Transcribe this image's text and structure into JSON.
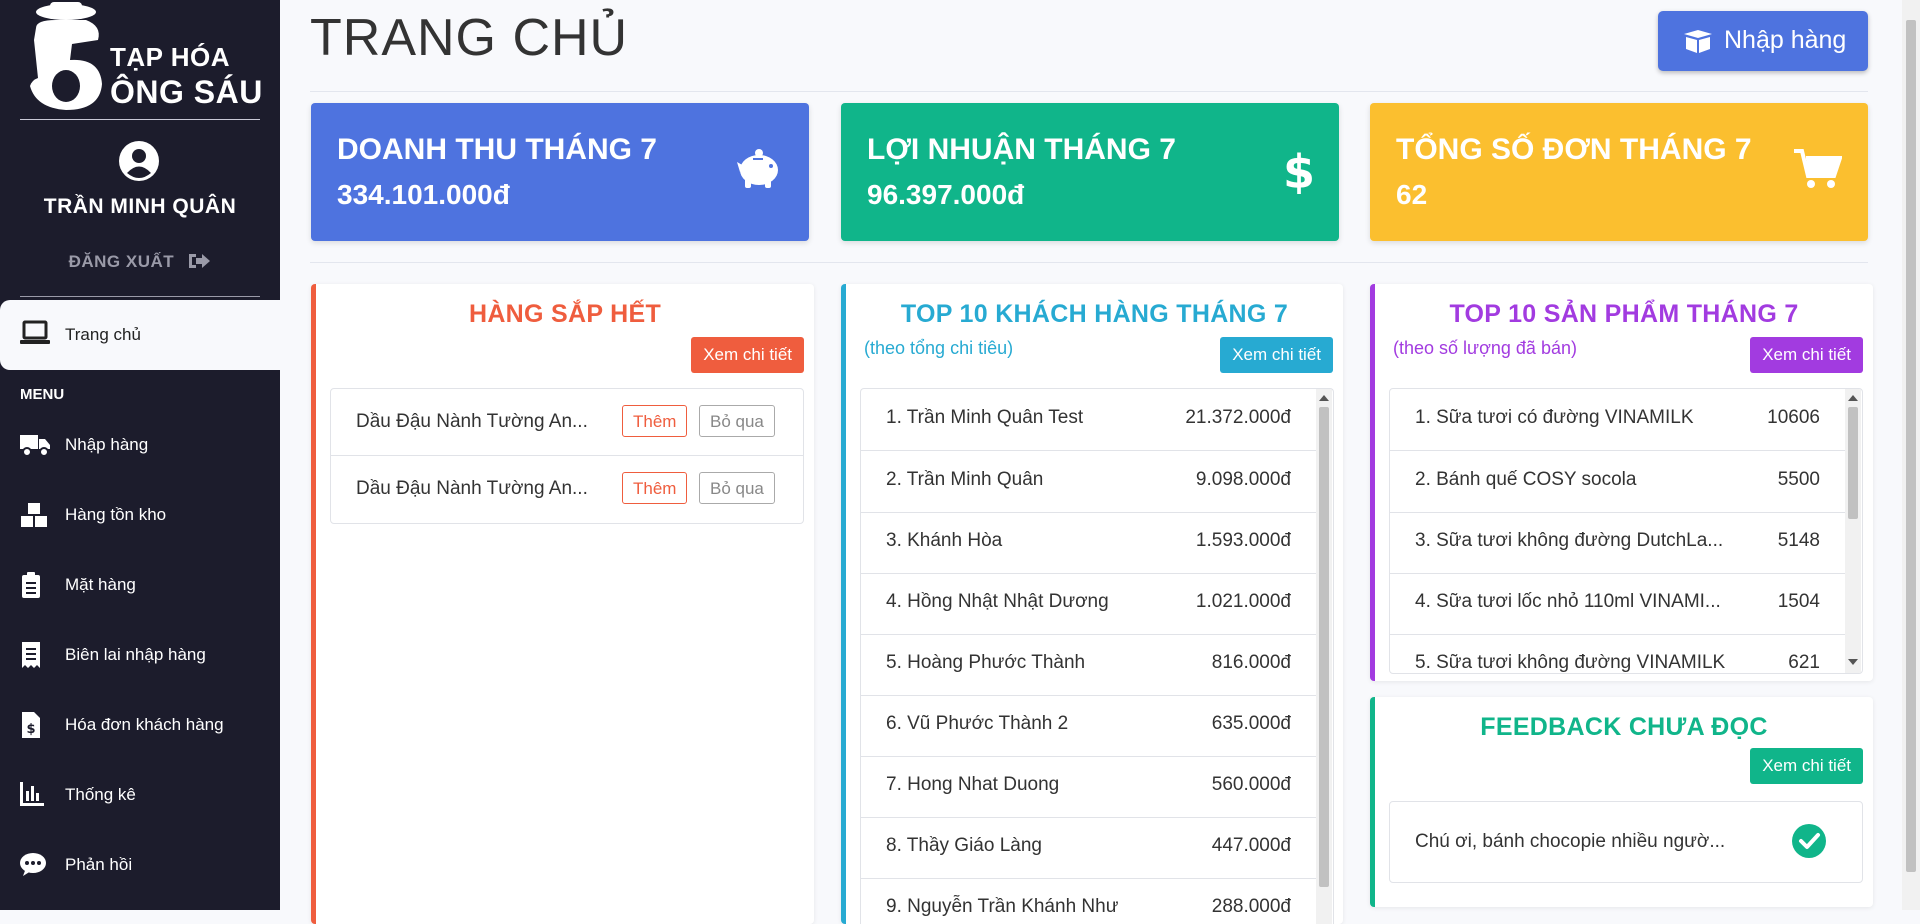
{
  "sidebar": {
    "logo_line1": "TẠP HÓA",
    "logo_line2": "ÔNG SÁU",
    "user_name": "TRẦN MINH QUÂN",
    "logout_label": "ĐĂNG XUẤT",
    "active_item": {
      "label": "Trang chủ",
      "icon": "laptop-icon"
    },
    "menu_heading": "MENU",
    "items": [
      {
        "label": "Nhập hàng",
        "icon": "truck-icon"
      },
      {
        "label": "Hàng tồn kho",
        "icon": "boxes-icon"
      },
      {
        "label": "Mặt hàng",
        "icon": "clipboard-list-icon"
      },
      {
        "label": "Biên lai nhập hàng",
        "icon": "receipt-icon"
      },
      {
        "label": "Hóa đơn khách hàng",
        "icon": "invoice-dollar-icon"
      },
      {
        "label": "Thống kê",
        "icon": "chart-bar-icon"
      },
      {
        "label": "Phản hồi",
        "icon": "comment-dots-icon"
      }
    ]
  },
  "header": {
    "title": "TRANG CHỦ",
    "import_button": "Nhập hàng"
  },
  "stats": [
    {
      "title": "DOANH THU THÁNG 7",
      "value": "334.101.000đ",
      "color": "#4e73df",
      "icon": "piggy-bank-icon"
    },
    {
      "title": "LỢI NHUẬN THÁNG 7",
      "value": "96.397.000đ",
      "color": "#10b58a",
      "icon": "dollar-icon"
    },
    {
      "title": "TỔNG SỐ ĐƠN THÁNG 7",
      "value": "62",
      "color": "#fbbf2f",
      "icon": "cart-icon"
    }
  ],
  "low_stock": {
    "title": "HÀNG SẮP HẾT",
    "detail_button": "Xem chi tiết",
    "color": "#ef5d3e",
    "items": [
      {
        "name": "Dầu Đậu Nành Tường An...",
        "add": "Thêm",
        "skip": "Bỏ qua"
      },
      {
        "name": "Dầu Đậu Nành Tường An...",
        "add": "Thêm",
        "skip": "Bỏ qua"
      }
    ]
  },
  "top_customers": {
    "title": "TOP 10 KHÁCH HÀNG THÁNG 7",
    "subtitle": "(theo tổng chi tiêu)",
    "detail_button": "Xem chi tiết",
    "color": "#27aad2",
    "rows": [
      {
        "name": "1. Trần Minh Quân Test",
        "amount": "21.372.000đ"
      },
      {
        "name": "2. Trần Minh Quân",
        "amount": "9.098.000đ"
      },
      {
        "name": "3. Khánh Hòa",
        "amount": "1.593.000đ"
      },
      {
        "name": "4. Hồng Nhật Nhật Dương",
        "amount": "1.021.000đ"
      },
      {
        "name": "5. Hoàng Phước Thành",
        "amount": "816.000đ"
      },
      {
        "name": "6. Vũ Phước Thành 2",
        "amount": "635.000đ"
      },
      {
        "name": "7. Hong Nhat Duong",
        "amount": "560.000đ"
      },
      {
        "name": "8. Thầy Giáo Làng",
        "amount": "447.000đ"
      },
      {
        "name": "9. Nguyễn Trần Khánh Như",
        "amount": "288.000đ"
      }
    ]
  },
  "top_products": {
    "title": "TOP 10 SẢN PHẨM THÁNG 7",
    "subtitle": "(theo số lượng đã bán)",
    "detail_button": "Xem chi tiết",
    "color": "#a23be0",
    "rows": [
      {
        "name": "1. Sữa tươi có đường VINAMILK",
        "qty": "10606"
      },
      {
        "name": "2. Bánh quế COSY socola",
        "qty": "5500"
      },
      {
        "name": "3. Sữa tươi không đường DutchLa...",
        "qty": "5148"
      },
      {
        "name": "4. Sữa tươi lốc nhỏ 110ml VINAMI...",
        "qty": "1504"
      },
      {
        "name": "5. Sữa tươi không đường VINAMILK",
        "qty": "621"
      }
    ]
  },
  "feedback": {
    "title": "FEEDBACK CHƯA ĐỌC",
    "detail_button": "Xem chi tiết",
    "color": "#10b58a",
    "items": [
      {
        "text": "Chú ơi, bánh chocopie nhiều ngườ..."
      }
    ]
  }
}
